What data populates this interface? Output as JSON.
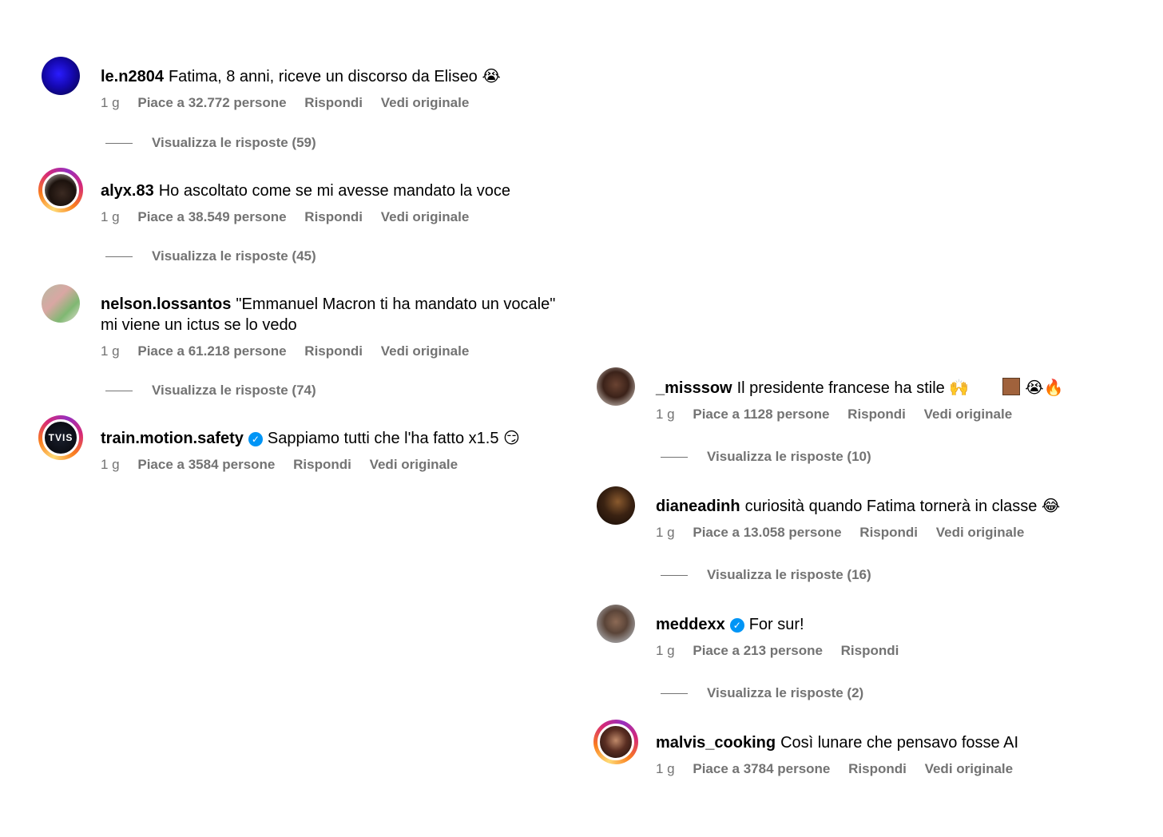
{
  "comments": [
    {
      "username": "le.n2804",
      "verified": false,
      "text": "Fatima, 8 anni, riceve un discorso da Eliseo 😭",
      "time": "1 g",
      "likes": "Piace a 32.772 persone",
      "reply": "Rispondi",
      "original": "Vedi originale",
      "replies": "Visualizza le risposte (59)"
    },
    {
      "username": "alyx.83",
      "verified": false,
      "text": "Ho ascoltato come se mi avesse mandato la voce",
      "time": "1 g",
      "likes": "Piace a 38.549 persone",
      "reply": "Rispondi",
      "original": "Vedi originale",
      "replies": "Visualizza le risposte (45)"
    },
    {
      "username": "nelson.lossantos",
      "verified": false,
      "text": "\"Emmanuel Macron ti ha mandato un vocale\" mi viene un ictus se lo vedo",
      "time": "1 g",
      "likes": "Piace a 61.218 persone",
      "reply": "Rispondi",
      "original": "Vedi originale",
      "replies": "Visualizza le risposte (74)"
    },
    {
      "username": "train.motion.safety",
      "verified": true,
      "text": "Sappiamo tutti che l'ha fatto x1.5 😏",
      "time": "1 g",
      "likes": "Piace a 3584 persone",
      "reply": "Rispondi",
      "original": "Vedi originale"
    },
    {
      "username": "_misssow",
      "verified": false,
      "text": "Il presidente francese ha stile 🙌",
      "text_tail": "😭🔥",
      "time": "1 g",
      "likes": "Piace a 1128 persone",
      "reply": "Rispondi",
      "original": "Vedi originale",
      "replies": "Visualizza le risposte (10)"
    },
    {
      "username": "dianeadinh",
      "verified": false,
      "text": "curiosità quando Fatima tornerà in classe 😂",
      "time": "1 g",
      "likes": "Piace a 13.058 persone",
      "reply": "Rispondi",
      "original": "Vedi originale",
      "replies": "Visualizza le risposte (16)"
    },
    {
      "username": "meddexx",
      "verified": true,
      "text": "For sur!",
      "time": "1 g",
      "likes": "Piace a 213 persone",
      "reply": "Rispondi",
      "replies": "Visualizza le risposte (2)"
    },
    {
      "username": "malvis_cooking",
      "verified": false,
      "text": "Così lunare che pensavo fosse AI",
      "time": "1 g",
      "likes": "Piace a 3784 persone",
      "reply": "Rispondi",
      "original": "Vedi originale"
    }
  ],
  "verified_icon": "verified-check-icon",
  "colors": {
    "meta": "#737373",
    "verified": "#0095f6"
  }
}
